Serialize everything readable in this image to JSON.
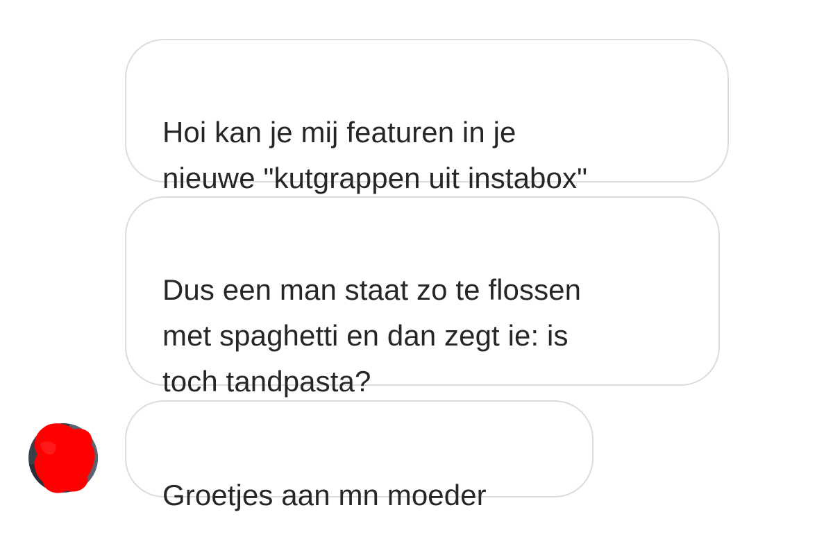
{
  "conversation": {
    "messages": [
      {
        "text": "Hoi kan je mij featuren in je\nnieuwe \"kutgrappen uit instabox\""
      },
      {
        "text": "Dus een man staat zo te flossen\nmet spaghetti en dan zegt ie: is\ntoch tandpasta?"
      },
      {
        "text": "Groetjes aan mn moeder"
      }
    ],
    "sender_avatar": {
      "icon": "avatar-redacted",
      "redaction_color": "#ff0000",
      "photo_tone": "#3a3f4a"
    },
    "bubble_border_color": "#dcdcdc",
    "text_color": "#262626"
  }
}
